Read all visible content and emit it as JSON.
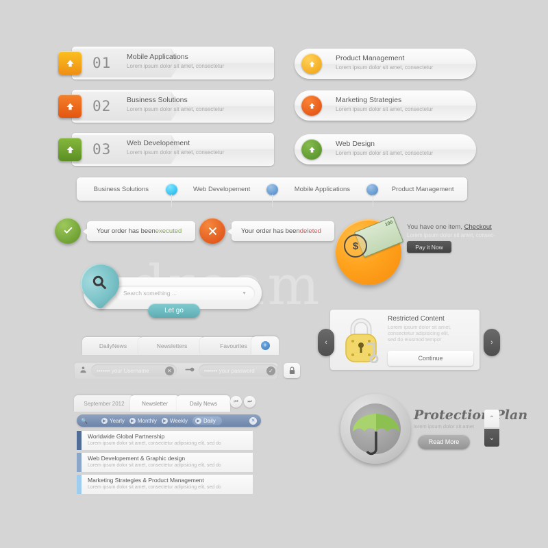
{
  "meta": {
    "background": "#d5d5d5",
    "watermark": "dream"
  },
  "numbered_rows": [
    {
      "num": "01",
      "title": "Mobile Applications",
      "sub": "Lorem ipsum dolor sit amet, consectetur",
      "color": "#f5a623",
      "icon": "arrow-up-icon"
    },
    {
      "num": "02",
      "title": "Business Solutions",
      "sub": "Lorem ipsum dolor sit amet, consectetur",
      "color": "#ee6b1f",
      "icon": "arrow-up-icon"
    },
    {
      "num": "03",
      "title": "Web Developement",
      "sub": "Lorem ipsum dolor sit amet, consectetur",
      "color": "#6ca32c",
      "icon": "arrow-up-icon"
    }
  ],
  "pill_rows": [
    {
      "title": "Product Management",
      "sub": "Lorem ipsum dolor sit amet, consectetur",
      "color": "#f7b320",
      "icon": "arrow-up-icon"
    },
    {
      "title": "Marketing Strategies",
      "sub": "Lorem ipsum dolor sit amet, consectetur",
      "color": "#ea5b1c",
      "icon": "arrow-up-icon"
    },
    {
      "title": "Web Design",
      "sub": "Lorem ipsum dolor sit amet, consectetur",
      "color": "#5f9b33",
      "icon": "arrow-up-icon"
    }
  ],
  "navbar": {
    "items": [
      {
        "label": "Business Solutions"
      },
      {
        "label": "Web Developement"
      },
      {
        "label": "Mobile Applications"
      },
      {
        "label": "Product Management"
      }
    ],
    "dots": [
      "#29c5f6",
      "#5b9bd5",
      "#5b9bd5"
    ]
  },
  "status": {
    "success": {
      "message_prefix": "Your order has been ",
      "highlight": "executed",
      "highlight_color": "#7aab3f",
      "icon": "check-icon",
      "icon_color": "#72a53a"
    },
    "error": {
      "message_prefix": "Your order has been ",
      "highlight": "deleted",
      "highlight_color": "#d9534f",
      "icon": "close-icon",
      "icon_color": "#e8591e"
    }
  },
  "checkout": {
    "title_prefix": "You have one item, ",
    "title_link": "Checkout",
    "sub": "Lorem ipsum dolor sit amet, consec-",
    "button": "Pay it Now",
    "bill_value": "100",
    "currency_symbol": "$"
  },
  "search": {
    "placeholder": "Search something ...",
    "button": "Let go",
    "icon": "magnifier-icon",
    "dropdown_icon": "caret-down-icon"
  },
  "tabs": {
    "items": [
      "DailyNews",
      "Newsletters",
      "Favourites"
    ],
    "add_icon": "plus-circle-icon"
  },
  "login": {
    "username_value": "••••••• your Username",
    "password_value": "••••••• your password",
    "user_icon": "person-icon",
    "key_icon": "key-icon",
    "clear_icon": "close-icon",
    "ok_icon": "check-icon",
    "lock_icon": "lock-icon"
  },
  "news_panel": {
    "tabs": [
      {
        "label": "September 2012",
        "active": false
      },
      {
        "label": "Newsletter",
        "active": true
      },
      {
        "label": "Daily News",
        "active": true
      }
    ],
    "prev_icon": "skip-back-icon",
    "next_icon": "skip-forward-icon",
    "search_icon": "magnifier-icon",
    "filters": [
      {
        "label": "Yearly",
        "active": false
      },
      {
        "label": "Monthly",
        "active": false
      },
      {
        "label": "Weekly",
        "active": false
      },
      {
        "label": "Daily",
        "active": true
      }
    ],
    "close_icon": "close-icon",
    "items": [
      {
        "title": "Worldwide Global Partnership",
        "sub": "Lorem ipsum dolor sit amet, consectetur adipisicing elit, sed do",
        "bar_color": "#4f6d96"
      },
      {
        "title": "Web Developement & Graphic design",
        "sub": "Lorem ipsum dolor sit amet, consectetur adipisicing elit, sed do",
        "bar_color": "#8aa6c9"
      },
      {
        "title": "Marketing Strategies & Product Management",
        "sub": "Lorem ipsum dolor sit amet, consectetur adipisicing elit, sed do",
        "bar_color": "#9ecdf0"
      }
    ]
  },
  "restricted": {
    "title": "Restricted Content",
    "lines": [
      "Lorem ipsum dolor sit amet,",
      "consectetur adipisicing elit,",
      "sed do eiusmod tempor"
    ],
    "button": "Continue",
    "prev_icon": "chevron-left-icon",
    "next_icon": "chevron-right-icon",
    "lock_icon": "padlock-icon",
    "lock_color": "#f4d35e"
  },
  "protection": {
    "title": "Protection Plan",
    "sub": "lorem ipsum dolor sit amet",
    "button": "Read More",
    "umbrella_icon": "umbrella-icon",
    "umbrella_color": "#8cc152",
    "up_icon": "chevron-up-icon",
    "down_icon": "chevron-down-icon"
  }
}
